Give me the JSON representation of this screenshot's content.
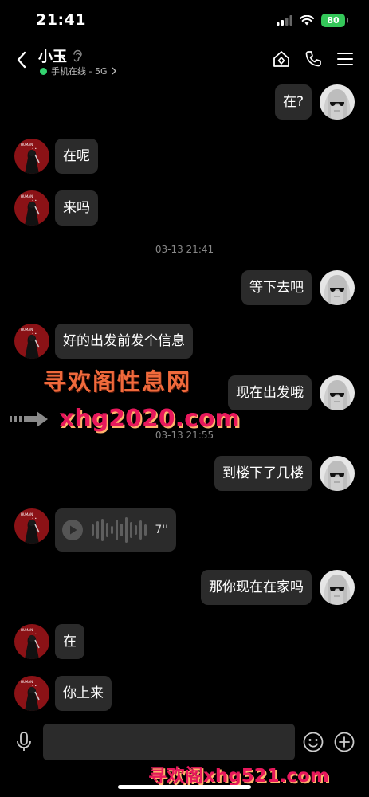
{
  "status_bar": {
    "time": "21:41",
    "battery": "80"
  },
  "header": {
    "contact_name": "小玉",
    "presence": "手机在线 - 5G",
    "icons": [
      "back-arrow-icon",
      "ear-icon",
      "home-icon",
      "phone-icon",
      "menu-icon"
    ]
  },
  "messages": [
    {
      "side": "out",
      "text": "在?"
    },
    {
      "side": "in",
      "text": "在呢"
    },
    {
      "side": "in",
      "text": "来吗"
    },
    {
      "side": "out",
      "text": "等下去吧"
    },
    {
      "side": "in",
      "text": "好的出发前发个信息"
    },
    {
      "side": "out",
      "text": "现在出发哦"
    },
    {
      "side": "out",
      "text": "到楼下了几楼"
    },
    {
      "side": "in",
      "type": "voice",
      "duration": "7''"
    },
    {
      "side": "out",
      "text": "那你现在在家吗"
    },
    {
      "side": "in",
      "text": "在"
    },
    {
      "side": "in",
      "text": "你上来"
    }
  ],
  "timestamps": [
    "03-13 21:41",
    "03-13 21:55"
  ],
  "watermark": {
    "cn_text": "寻欢阁性息网",
    "url_text": "xhg2020.com",
    "bottom_text": "寻欢阁xhg521.com"
  },
  "input_bar": {
    "value": "",
    "icons": [
      "microphone-icon",
      "emoji-icon",
      "plus-icon"
    ]
  },
  "colors": {
    "background": "#000000",
    "bubble": "#2b2b2b",
    "online": "#33d36f",
    "battery": "#34c759"
  }
}
